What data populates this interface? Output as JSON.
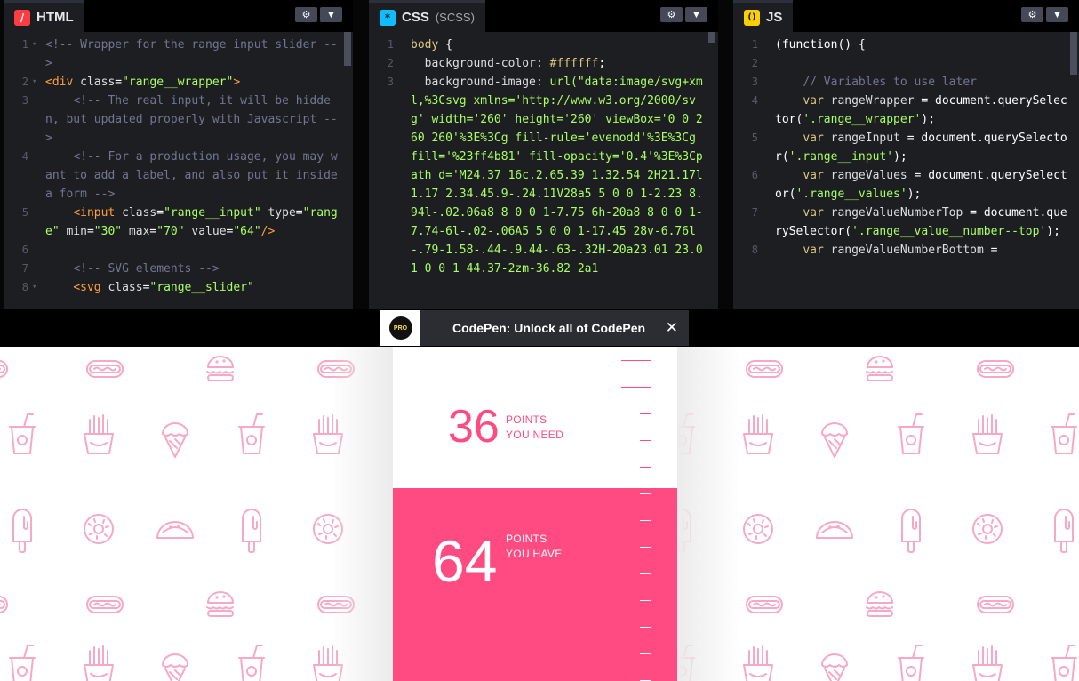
{
  "editors": {
    "html": {
      "title": "HTML",
      "icon": "/",
      "settings_icon": "⚙",
      "chevron_icon": "▼",
      "lines": [
        {
          "n": "1",
          "fold": "▾",
          "segs": [
            {
              "c": "comment",
              "t": "<!-- Wrapper for the range input slider -->"
            }
          ]
        },
        {
          "n": "2",
          "fold": "▾",
          "segs": [
            {
              "c": "tag",
              "t": "<div "
            },
            {
              "c": "attr",
              "t": "class"
            },
            {
              "c": "fn",
              "t": "="
            },
            {
              "c": "val",
              "t": "\"range__wrapper\""
            },
            {
              "c": "tag",
              "t": ">"
            }
          ]
        },
        {
          "n": "3",
          "fold": "",
          "segs": [
            {
              "c": "comment",
              "t": "    <!-- The real input, it will be hidden, but updated properly with Javascript -->"
            }
          ]
        },
        {
          "n": "4",
          "fold": "",
          "segs": [
            {
              "c": "comment",
              "t": "    <!-- For a production usage, you may want to add a label, and also put it inside a form -->"
            }
          ]
        },
        {
          "n": "5",
          "fold": "",
          "segs": [
            {
              "c": "tag",
              "t": "    <input "
            },
            {
              "c": "attr",
              "t": "class"
            },
            {
              "c": "fn",
              "t": "="
            },
            {
              "c": "val",
              "t": "\"range__input\""
            },
            {
              "c": "attr",
              "t": " type"
            },
            {
              "c": "fn",
              "t": "="
            },
            {
              "c": "val",
              "t": "\"range\""
            },
            {
              "c": "attr",
              "t": " min"
            },
            {
              "c": "fn",
              "t": "="
            },
            {
              "c": "val",
              "t": "\"30\""
            },
            {
              "c": "attr",
              "t": " max"
            },
            {
              "c": "fn",
              "t": "="
            },
            {
              "c": "val",
              "t": "\"70\""
            },
            {
              "c": "attr",
              "t": " value"
            },
            {
              "c": "fn",
              "t": "="
            },
            {
              "c": "val",
              "t": "\"64\""
            },
            {
              "c": "tag",
              "t": "/>"
            }
          ]
        },
        {
          "n": "6",
          "fold": "",
          "segs": [
            {
              "c": "fn",
              "t": ""
            }
          ]
        },
        {
          "n": "7",
          "fold": "",
          "segs": [
            {
              "c": "comment",
              "t": "    <!-- SVG elements -->"
            }
          ]
        },
        {
          "n": "8",
          "fold": "▾",
          "segs": [
            {
              "c": "tag",
              "t": "    <svg "
            },
            {
              "c": "attr",
              "t": "class"
            },
            {
              "c": "fn",
              "t": "="
            },
            {
              "c": "val",
              "t": "\"range__slider\""
            }
          ]
        }
      ]
    },
    "css": {
      "title": "CSS",
      "subtitle": "(SCSS)",
      "icon": "*",
      "settings_icon": "⚙",
      "chevron_icon": "▼",
      "lines": [
        {
          "n": "1",
          "fold": "",
          "segs": [
            {
              "c": "kw",
              "t": "body "
            },
            {
              "c": "fn",
              "t": "{"
            }
          ]
        },
        {
          "n": "2",
          "fold": "",
          "segs": [
            {
              "c": "prop",
              "t": "  background-color"
            },
            {
              "c": "fn",
              "t": ": "
            },
            {
              "c": "kw",
              "t": "#ffffff"
            },
            {
              "c": "fn",
              "t": ";"
            }
          ]
        },
        {
          "n": "3",
          "fold": "",
          "segs": [
            {
              "c": "prop",
              "t": "  background-image"
            },
            {
              "c": "fn",
              "t": ": "
            },
            {
              "c": "str",
              "t": "url(\"data:image/svg+xml,%3Csvg xmlns='http://www.w3.org/2000/svg' width='260' height='260' viewBox='0 0 260 260'%3E%3Cg fill-rule='evenodd'%3E%3Cg fill='%23ff4b81' fill-opacity='0.4'%3E%3Cpath d='M24.37 16c.2.65.39 1.32.54 2H21.17l1.17 2.34.45.9-.24.11V28a5 5 0 0 1-2.23 8.94l-.02.06a8 8 0 0 1-7.75 6h-20a8 8 0 0 1-7.74-6l-.02-.06A5 5 0 0 1-17.45 28v-6.76l-.79-1.58-.44-.9.44-.63-.32H-20a23.01 23.01 0 0 1 44.37-2zm-36.82 2a1"
            }
          ]
        }
      ]
    },
    "js": {
      "title": "JS",
      "icon": "()",
      "settings_icon": "⚙",
      "chevron_icon": "▼",
      "lines": [
        {
          "n": "1",
          "fold": "",
          "segs": [
            {
              "c": "fn",
              "t": "(function() {"
            }
          ]
        },
        {
          "n": "2",
          "fold": "",
          "segs": [
            {
              "c": "fn",
              "t": ""
            }
          ]
        },
        {
          "n": "3",
          "fold": "",
          "segs": [
            {
              "c": "comment",
              "t": "    // Variables to use later"
            }
          ]
        },
        {
          "n": "4",
          "fold": "",
          "segs": [
            {
              "c": "kw",
              "t": "    var "
            },
            {
              "c": "attr",
              "t": "rangeWrapper "
            },
            {
              "c": "fn",
              "t": "= document."
            },
            {
              "c": "fn",
              "t": "querySelector("
            },
            {
              "c": "str",
              "t": "'.range__wrapper'"
            },
            {
              "c": "fn",
              "t": ");"
            }
          ]
        },
        {
          "n": "5",
          "fold": "",
          "segs": [
            {
              "c": "kw",
              "t": "    var "
            },
            {
              "c": "attr",
              "t": "rangeInput "
            },
            {
              "c": "fn",
              "t": "= document."
            },
            {
              "c": "fn",
              "t": "querySelector("
            },
            {
              "c": "str",
              "t": "'.range__input'"
            },
            {
              "c": "fn",
              "t": ");"
            }
          ]
        },
        {
          "n": "6",
          "fold": "",
          "segs": [
            {
              "c": "kw",
              "t": "    var "
            },
            {
              "c": "attr",
              "t": "rangeValues "
            },
            {
              "c": "fn",
              "t": "= document."
            },
            {
              "c": "fn",
              "t": "querySelector("
            },
            {
              "c": "str",
              "t": "'.range__values'"
            },
            {
              "c": "fn",
              "t": ");"
            }
          ]
        },
        {
          "n": "7",
          "fold": "",
          "segs": [
            {
              "c": "kw",
              "t": "    var "
            },
            {
              "c": "attr",
              "t": "rangeValueNumberTop "
            },
            {
              "c": "fn",
              "t": "= document."
            },
            {
              "c": "fn",
              "t": "querySelector("
            },
            {
              "c": "str",
              "t": "'.range__value__number--top'"
            },
            {
              "c": "fn",
              "t": ");"
            }
          ]
        },
        {
          "n": "8",
          "fold": "",
          "segs": [
            {
              "c": "kw",
              "t": "    var "
            },
            {
              "c": "attr",
              "t": "rangeValueNumberBottom "
            },
            {
              "c": "fn",
              "t": "="
            }
          ]
        }
      ]
    }
  },
  "banner": {
    "badge": "PRO",
    "text": "CodePen: Unlock all of CodePen",
    "close": "✕"
  },
  "widget": {
    "need_value": "36",
    "need_line1": "POINTS",
    "need_line2": "YOU NEED",
    "have_value": "64",
    "have_line1": "POINTS",
    "have_line2": "YOU HAVE",
    "range_min": 30,
    "range_max": 70,
    "value": 64
  },
  "colors": {
    "accent": "#ff4b81",
    "pattern": "#f7a8c4",
    "editor_bg": "#1d1e22"
  }
}
